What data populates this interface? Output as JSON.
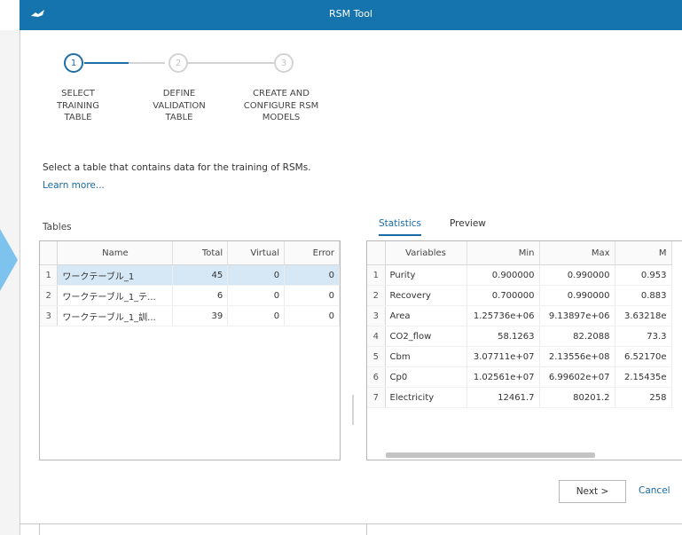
{
  "window": {
    "title": "RSM Tool"
  },
  "colors": {
    "titlebar": "#1574ad",
    "accent": "#1e6fa8",
    "selected_row": "#d6e7f5",
    "arrow": "#7ec2ee"
  },
  "stepper": {
    "steps": [
      {
        "number": "1",
        "lines": [
          "SELECT",
          "TRAINING",
          "TABLE"
        ],
        "state": "active"
      },
      {
        "number": "2",
        "lines": [
          "DEFINE",
          "VALIDATION",
          "TABLE"
        ],
        "state": "inactive"
      },
      {
        "number": "3",
        "lines": [
          "CREATE AND",
          "CONFIGURE RSM",
          "MODELS"
        ],
        "state": "inactive"
      }
    ]
  },
  "description": "Select a table that contains data for the training of RSMs.",
  "learn_more": "Learn more...",
  "tables_panel": {
    "label": "Tables",
    "columns": [
      "Name",
      "Total",
      "Virtual",
      "Error"
    ],
    "rows": [
      {
        "index": "1",
        "name": "ワークテーブル_1",
        "total": "45",
        "virtual": "0",
        "error": "0",
        "selected": true
      },
      {
        "index": "2",
        "name": "ワークテーブル_1_テ...",
        "total": "6",
        "virtual": "0",
        "error": "0",
        "selected": false
      },
      {
        "index": "3",
        "name": "ワークテーブル_1_訓...",
        "total": "39",
        "virtual": "0",
        "error": "0",
        "selected": false
      }
    ]
  },
  "tabs": [
    {
      "label": "Statistics",
      "active": true
    },
    {
      "label": "Preview",
      "active": false
    }
  ],
  "statistics": {
    "columns": [
      "Variables",
      "Min",
      "Max",
      "M"
    ],
    "rows": [
      {
        "index": "1",
        "variable": "Purity",
        "min": "0.900000",
        "max": "0.990000",
        "mean": "0.953"
      },
      {
        "index": "2",
        "variable": "Recovery",
        "min": "0.700000",
        "max": "0.990000",
        "mean": "0.883"
      },
      {
        "index": "3",
        "variable": "Area",
        "min": "1.25736e+06",
        "max": "9.13897e+06",
        "mean": "3.63218e"
      },
      {
        "index": "4",
        "variable": "CO2_flow",
        "min": "58.1263",
        "max": "82.2088",
        "mean": "73.3"
      },
      {
        "index": "5",
        "variable": "Cbm",
        "min": "3.07711e+07",
        "max": "2.13556e+08",
        "mean": "6.52170e"
      },
      {
        "index": "6",
        "variable": "Cp0",
        "min": "1.02561e+07",
        "max": "6.99602e+07",
        "mean": "2.15435e"
      },
      {
        "index": "7",
        "variable": "Electricity",
        "min": "12461.7",
        "max": "80201.2",
        "mean": "258"
      }
    ]
  },
  "buttons": {
    "next": "Next >",
    "cancel": "Cancel"
  }
}
